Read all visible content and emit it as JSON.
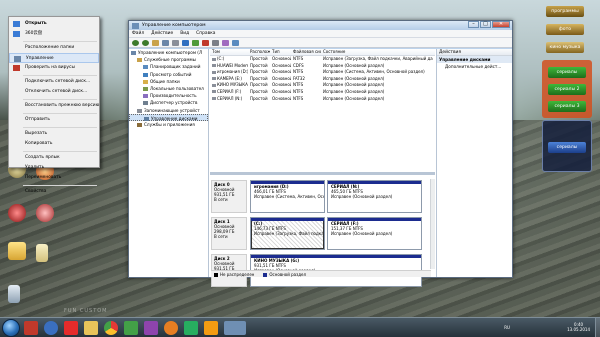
{
  "context_menu": {
    "items": [
      {
        "label": "Открыть",
        "bold": true,
        "icon": "open-icon"
      },
      {
        "label": "360云盘",
        "icon": "cloud-360-icon"
      },
      {
        "sep": true
      },
      {
        "label": "Расположение папки"
      },
      {
        "label": "Управление",
        "selected": true,
        "icon": "manage-icon"
      },
      {
        "label": "Проверить на вирусы",
        "icon": "antivirus-icon"
      },
      {
        "sep": true
      },
      {
        "label": "Подключить сетевой диск..."
      },
      {
        "label": "Отключить сетевой диск..."
      },
      {
        "sep": true
      },
      {
        "label": "Восстановить прежнюю версию"
      },
      {
        "sep": true
      },
      {
        "label": "Отправить"
      },
      {
        "sep": true
      },
      {
        "label": "Вырезать"
      },
      {
        "label": "Копировать"
      },
      {
        "sep": true
      },
      {
        "label": "Создать ярлык"
      },
      {
        "label": "Удалить"
      },
      {
        "label": "Переименовать"
      },
      {
        "sep": true
      },
      {
        "label": "Свойства"
      }
    ]
  },
  "window": {
    "title": "Управление компьютером",
    "menu": [
      "Файл",
      "Действие",
      "Вид",
      "Справка"
    ],
    "tree": [
      {
        "label": "Управление компьютером (Л",
        "level": 0,
        "icon": "computer-icon"
      },
      {
        "label": "Служебные программы",
        "level": 1,
        "icon": "tools-icon"
      },
      {
        "label": "Планировщик заданий",
        "level": 2,
        "icon": "scheduler-icon"
      },
      {
        "label": "Просмотр событий",
        "level": 2,
        "icon": "event-viewer-icon"
      },
      {
        "label": "Общие папки",
        "level": 2,
        "icon": "shared-folders-icon"
      },
      {
        "label": "Локальные пользовател",
        "level": 2,
        "icon": "users-icon"
      },
      {
        "label": "Производительность",
        "level": 2,
        "icon": "performance-icon"
      },
      {
        "label": "Диспетчер устройств",
        "level": 2,
        "icon": "device-manager-icon"
      },
      {
        "label": "Запоминающие устройст",
        "level": 1,
        "icon": "storage-icon"
      },
      {
        "label": "Управление дисками",
        "level": 2,
        "icon": "disk-management-icon",
        "selected": true
      },
      {
        "label": "Службы и приложения",
        "level": 1,
        "icon": "services-icon"
      }
    ],
    "volumes": {
      "headers": [
        "Том",
        "Расположение",
        "Тип",
        "Файловая система",
        "Состояние"
      ],
      "rows": [
        [
          "(C:)",
          "Простой",
          "Основной",
          "NTFS",
          "Исправен (Загрузка, Файл подкачки, Аварийный дамп, Основной раздел)"
        ],
        [
          "HUAWEI Modem 3.0 (H:)",
          "Простой",
          "Основной",
          "CDFS",
          "Исправен (Основной раздел)"
        ],
        [
          "игромания (D:)",
          "Простой",
          "Основной",
          "NTFS",
          "Исправен (Система, Активен, Основной раздел)"
        ],
        [
          "КАМЕРА (E:)",
          "Простой",
          "Основной",
          "FAT32",
          "Исправен (Основной раздел)"
        ],
        [
          "КИНО МУЗЫКА (G:)",
          "Простой",
          "Основной",
          "NTFS",
          "Исправен (Основной раздел)"
        ],
        [
          "СЕРИАЛ (F:)",
          "Простой",
          "Основной",
          "NTFS",
          "Исправен (Основной раздел)"
        ],
        [
          "СЕРИАЛ (N:)",
          "Простой",
          "Основной",
          "NTFS",
          "Исправен (Основной раздел)"
        ]
      ]
    },
    "disks": [
      {
        "name": "Диск 0",
        "type": "Основной",
        "size": "931,51 ГБ",
        "status": "В сети",
        "partitions": [
          {
            "name": "игромания (D:)",
            "size": "466,01 ГБ NTFS",
            "status": "Исправен (Система, Активен, Основной раздел)"
          },
          {
            "name": "СЕРИАЛ (N:)",
            "size": "465,50 ГБ NTFS",
            "status": "Исправен (Основной раздел)"
          }
        ]
      },
      {
        "name": "Диск 1",
        "type": "Основной",
        "size": "298,09 ГБ",
        "status": "В сети",
        "partitions": [
          {
            "name": "(C:)",
            "size": "146,73 ГБ NTFS",
            "status": "Исправен (Загрузка, Файл подкачки, Авар",
            "selected": true
          },
          {
            "name": "СЕРИАЛ (F:)",
            "size": "151,37 ГБ NTFS",
            "status": "Исправен (Основной раздел)"
          }
        ]
      },
      {
        "name": "Диск 2",
        "type": "Основной",
        "size": "931,51 ГБ",
        "status": "В сети",
        "partitions": [
          {
            "name": "КИНО МУЗЫКА (G:)",
            "size": "931,51 ГБ NTFS",
            "status": "Исправен (Основной раздел)"
          }
        ]
      }
    ],
    "legend": [
      {
        "label": "Не распределен",
        "color": "#000000"
      },
      {
        "label": "Основной раздел",
        "color": "#1c2c8f"
      }
    ],
    "actions": {
      "header": "Действия",
      "section": "Управление дисками",
      "items": [
        "Дополнительные дейст..."
      ]
    }
  },
  "widgets": [
    {
      "label": "программы",
      "color": "#8a6d1c"
    },
    {
      "label": "фото",
      "color": "#a27a1f"
    },
    {
      "label": "кино музыка",
      "color": "#b58a2a"
    },
    {
      "label": "сериалы",
      "color": "#c65f17"
    },
    {
      "label": "сериалы 2",
      "color": "#3a8b2b"
    },
    {
      "label": "сериалы 3",
      "color": "#2f7c2b"
    },
    {
      "label": "сериалы",
      "color": "#2753a3"
    }
  ],
  "taskbar": {
    "lang": "RU",
    "time": "0:40",
    "date": "13.05.2014"
  },
  "watermark": "FUN CUSTOM"
}
